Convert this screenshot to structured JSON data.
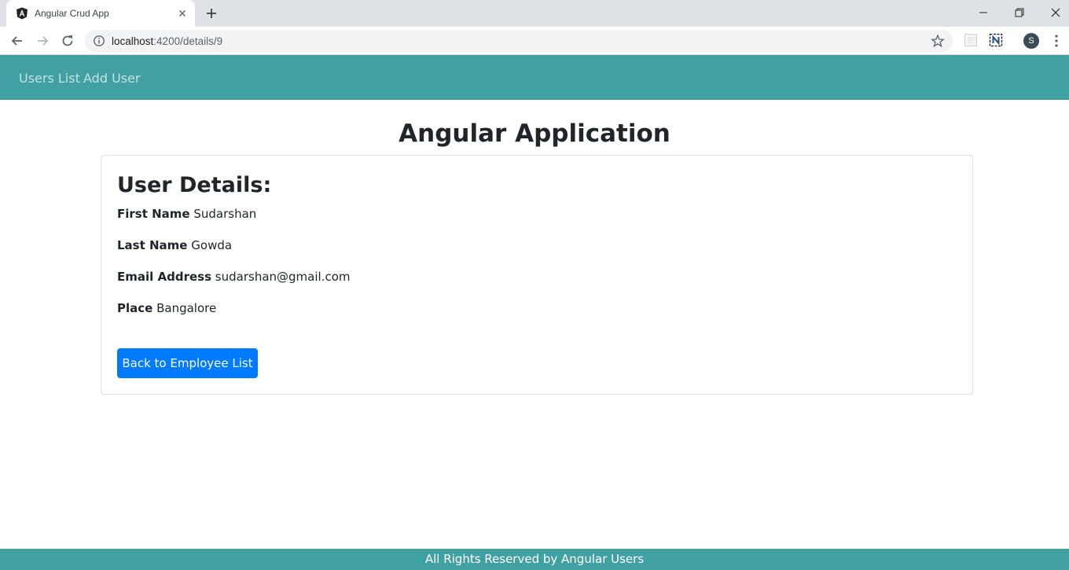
{
  "browser": {
    "tab_title": "Angular Crud App",
    "url_host": "localhost",
    "url_rest": ":4200/details/9",
    "profile_initial": "S"
  },
  "nav": {
    "users_list": "Users List",
    "add_user": "Add User"
  },
  "page": {
    "title": "Angular Application"
  },
  "details": {
    "heading": "User Details:",
    "fields": [
      {
        "label": "First Name",
        "value": "Sudarshan"
      },
      {
        "label": "Last Name",
        "value": "Gowda"
      },
      {
        "label": "Email Address",
        "value": "sudarshan@gmail.com"
      },
      {
        "label": "Place",
        "value": "Bangalore"
      }
    ],
    "back_button": "Back to Employee List"
  },
  "footer": {
    "text": "All Rights Reserved by Angular Users"
  },
  "colors": {
    "nav_bg": "#41a0a2",
    "button_primary": "#007bff"
  }
}
